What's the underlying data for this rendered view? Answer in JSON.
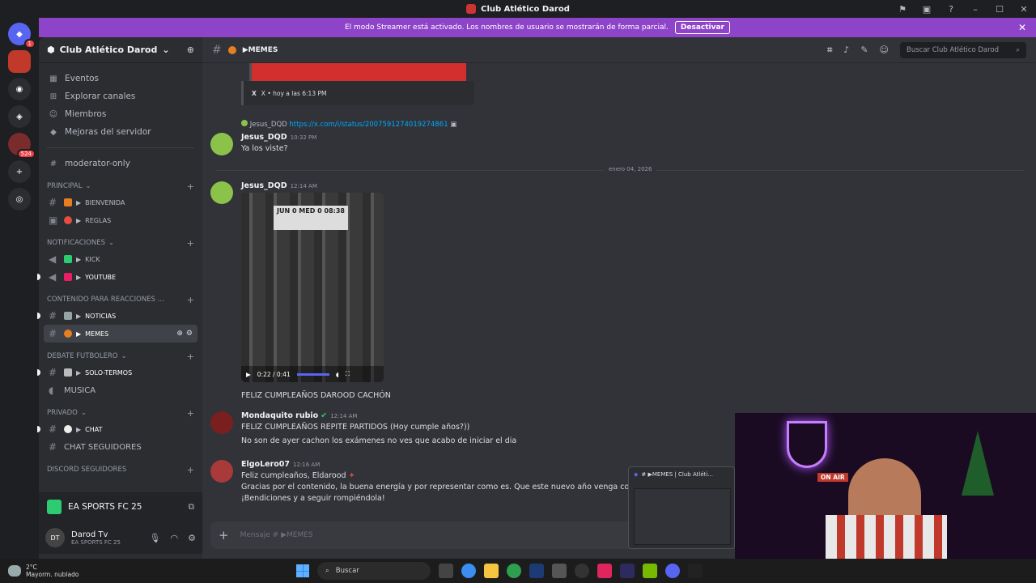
{
  "window": {
    "title": "Club Atlético Darod"
  },
  "banner": {
    "text": "El modo Streamer está activado. Los nombres de usuario se mostrarán de forma parcial.",
    "button": "Desactivar"
  },
  "rail": {
    "badge_dm": "1",
    "badge_server": "524"
  },
  "server": {
    "name": "Club Atlético Darod",
    "nav": [
      {
        "label": "Eventos",
        "icon": "calendar-icon"
      },
      {
        "label": "Explorar canales",
        "icon": "compass-icon"
      },
      {
        "label": "Miembros",
        "icon": "members-icon"
      },
      {
        "label": "Mejoras del servidor",
        "icon": "boost-icon"
      }
    ],
    "moderator_channel": "moderator-only",
    "categories": [
      {
        "label": "PRINCIPAL",
        "channels": [
          "BIENVENIDA",
          "REGLAS"
        ]
      },
      {
        "label": "NOTIFICACIONES",
        "channels": [
          "KICK",
          "YOUTUBE"
        ]
      },
      {
        "label": "CONTENIDO PARA REACCIONES ...",
        "channels": [
          "NOTICIAS",
          "MEMES"
        ]
      },
      {
        "label": "DEBATE FUTBOLERO",
        "channels": [
          "SOLO-TERMOS",
          "MUSICA"
        ]
      },
      {
        "label": "PRIVADO",
        "channels": [
          "CHAT",
          "CHAT SEGUIDORES"
        ]
      },
      {
        "label": "DISCORD SEGUIDORES",
        "channels": []
      }
    ]
  },
  "activity": {
    "game": "EA SPORTS FC 25"
  },
  "user": {
    "name": "Darod Tv",
    "status": "EA SPORTS FC 25"
  },
  "channel": {
    "name": "MEMES",
    "search_placeholder": "Buscar Club Atlético Darod"
  },
  "messages": {
    "embed_footer": "X • hoy a las 6:13 PM",
    "reply_user": "Jesus_DQD",
    "reply_link": "https://x.com/i/status/2007591274019274861",
    "m1": {
      "user": "Jesus_DQD",
      "time": "10:32 PM",
      "text": "Ya los viste?"
    },
    "date_divider": "enero 04, 2026",
    "m2": {
      "user": "Jesus_DQD",
      "time": "12:14 AM",
      "video_label": "JUN 0  MED 0  08:38",
      "video_time": "0:22 / 0:41",
      "text": "FELIZ CUMPLEAÑOS DAROOD CACHÓN"
    },
    "m3": {
      "user": "Mondaquito rubio",
      "time": "12:14 AM",
      "line1": "FELIZ CUMPLEAÑOS REPITE PARTIDOS (Hoy cumple años?))",
      "line2": "No son de ayer cachon los exámenes no ves que acabo de iniciar el dia"
    },
    "m4": {
      "user": "ElgoLero07",
      "time": "12:16 AM",
      "line1": "Feliz cumpleaños, Eldarood",
      "line2": "Gracias por el contenido, la buena energía y por representar como es. Que este nuevo año venga con much",
      "line3": "¡Bendiciones y a seguir rompiéndola!"
    }
  },
  "composer": {
    "placeholder": "Mensaje # ▶MEMES"
  },
  "pip": {
    "title": "# ▶MEMES | Club Atléti..."
  },
  "webcam": {
    "sign": "ON AIR"
  },
  "taskbar": {
    "temp": "2°C",
    "weather": "Mayorm. nublado",
    "search": "Buscar"
  },
  "colors": {
    "accent": "#5865f2",
    "banner": "#8e44c9",
    "link": "#00a8fc"
  }
}
